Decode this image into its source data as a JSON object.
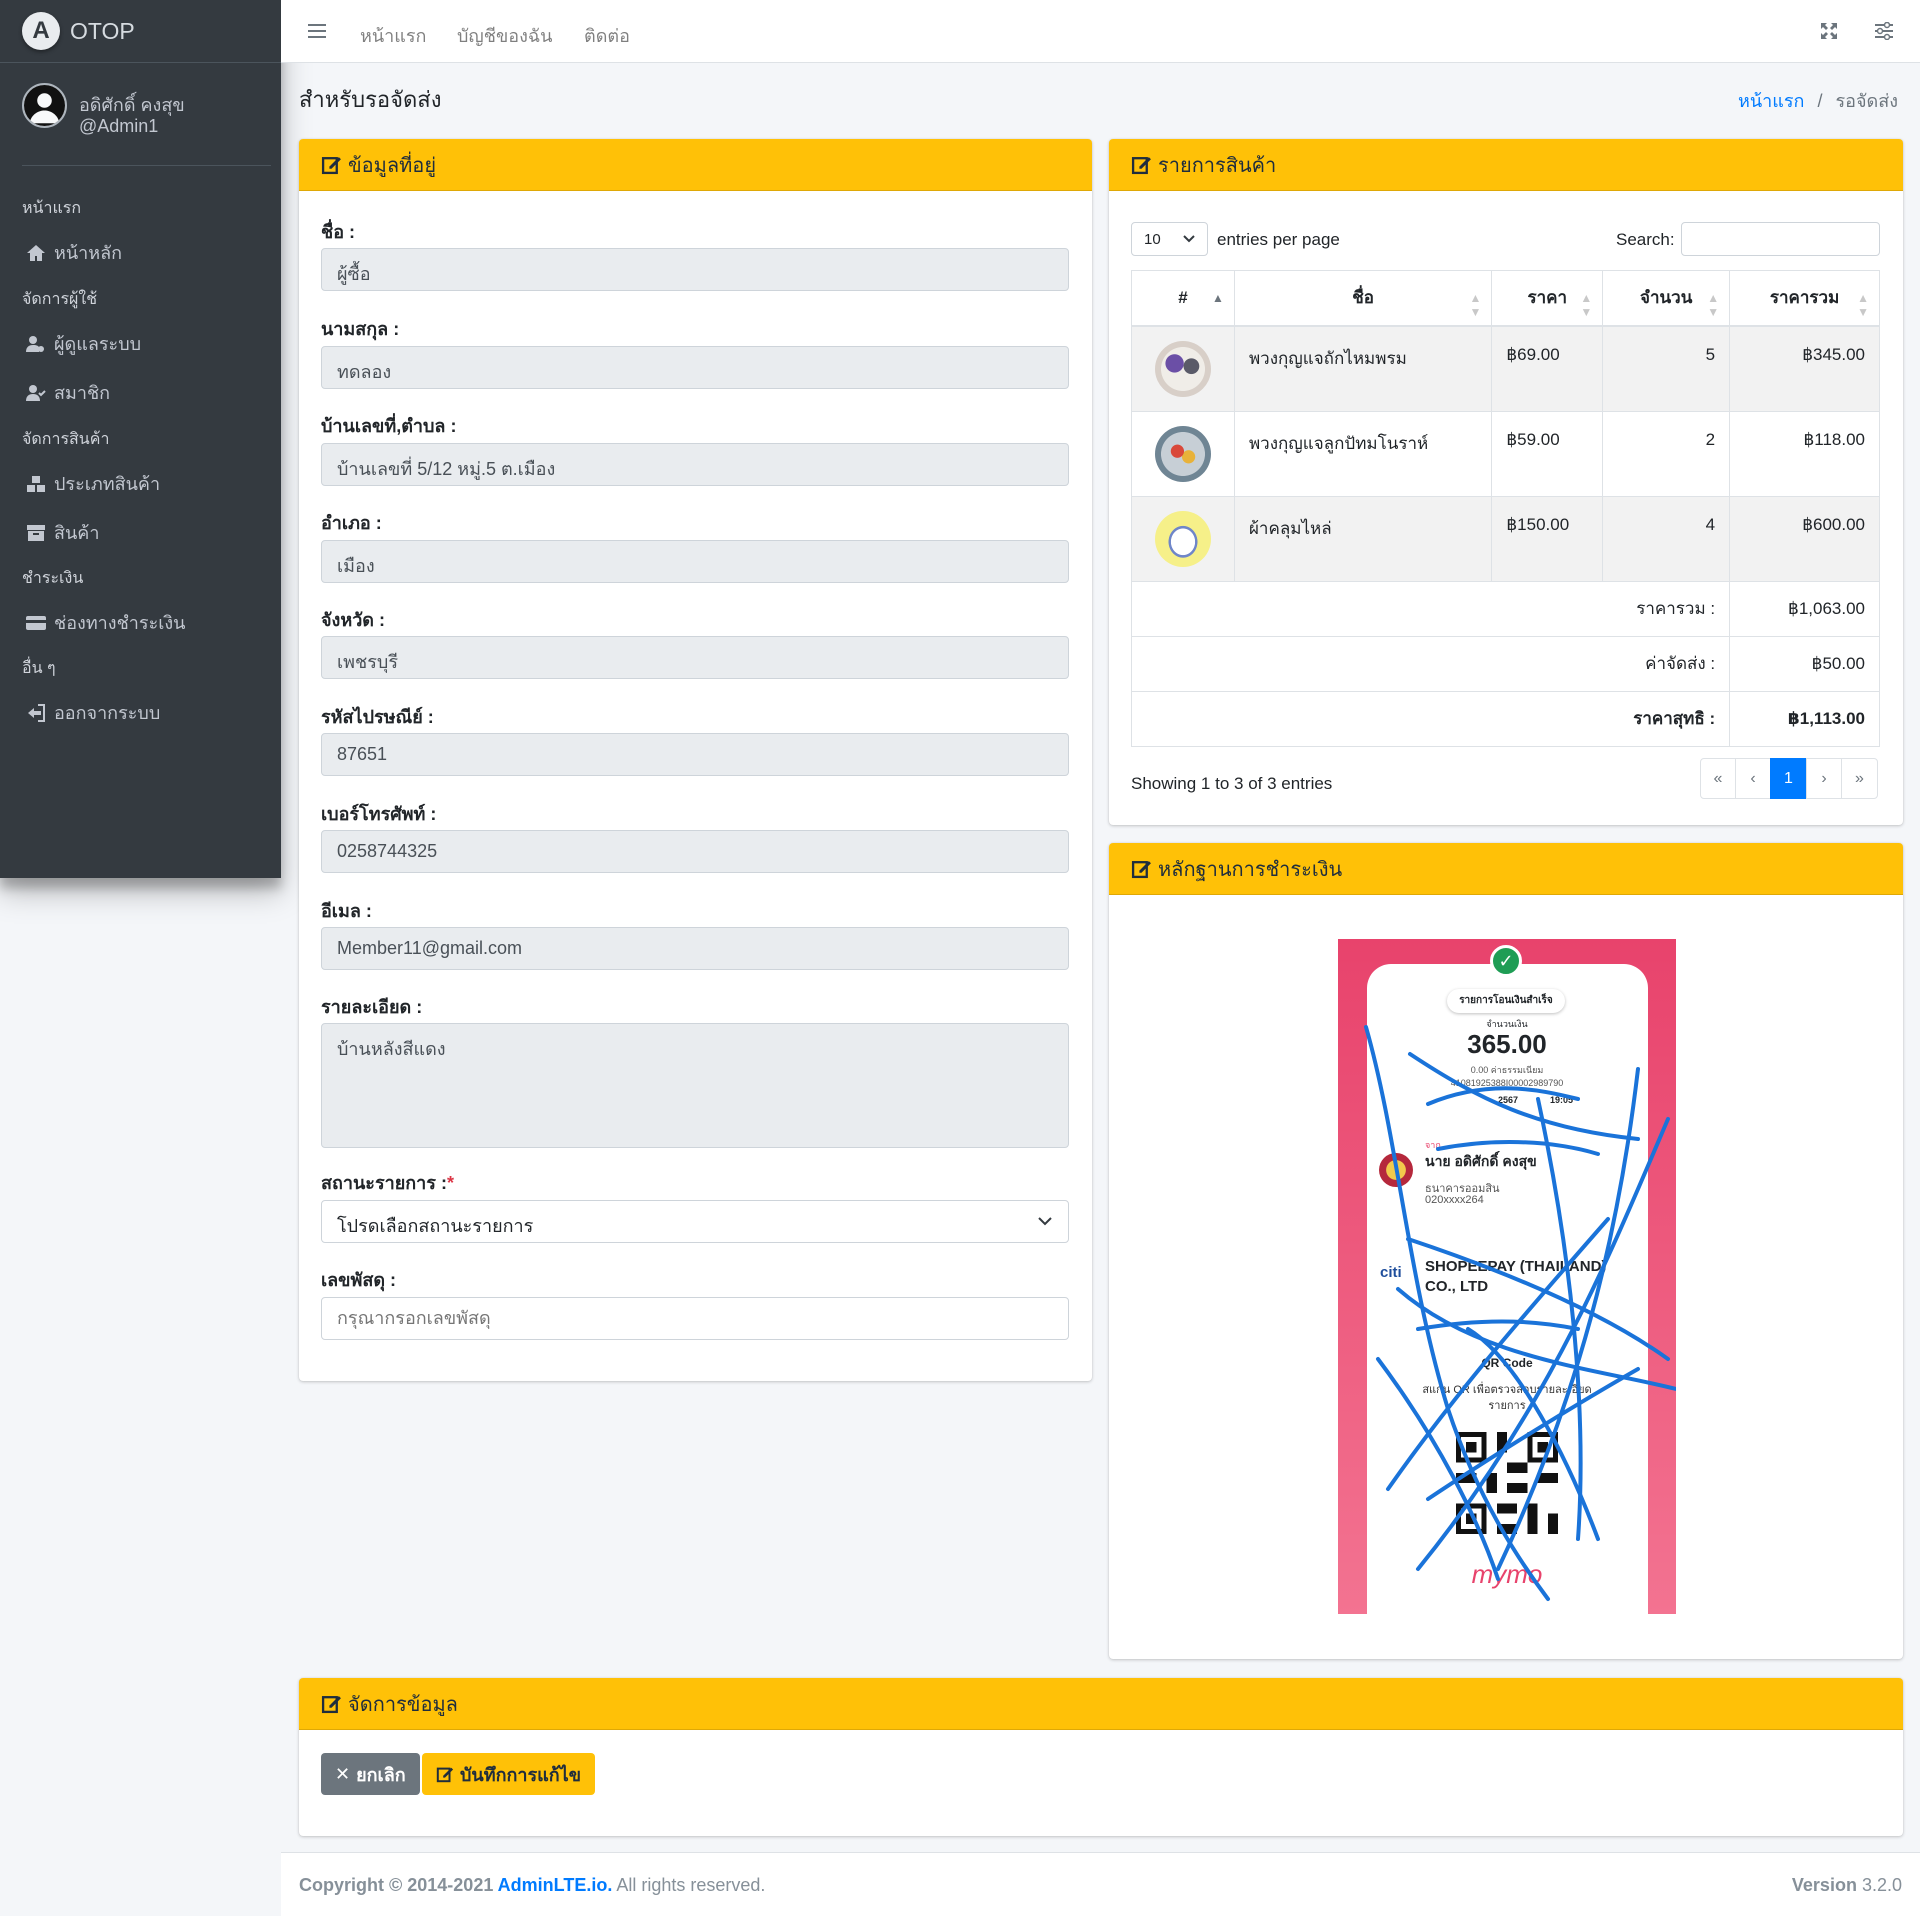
{
  "brand": {
    "name": "OTOP",
    "logo_letter": "A"
  },
  "user": {
    "name": "อดิศักดิ์ คงสุข",
    "handle": "@Admin1"
  },
  "sidebar": {
    "headers": [
      "หน้าแรก",
      "จัดการผู้ใช้",
      "จัดการสินค้า",
      "ชำระเงิน",
      "อื่น ๆ"
    ],
    "items": [
      {
        "label": "หน้าหลัก",
        "icon": "home-icon"
      },
      {
        "label": "ผู้ดูแลระบบ",
        "icon": "user-cog-icon"
      },
      {
        "label": "สมาชิก",
        "icon": "user-check-icon"
      },
      {
        "label": "ประเภทสินค้า",
        "icon": "cubes-icon"
      },
      {
        "label": "สินค้า",
        "icon": "archive-icon"
      },
      {
        "label": "ช่องทางชำระเงิน",
        "icon": "credit-card-icon"
      },
      {
        "label": "ออกจากระบบ",
        "icon": "sign-out-icon"
      }
    ]
  },
  "topnav": {
    "links": [
      "หน้าแรก",
      "บัญชีของฉัน",
      "ติดต่อ"
    ]
  },
  "page": {
    "title": "สำหรับรอจัดส่ง",
    "breadcrumb_home": "หน้าแรก",
    "breadcrumb_sep": "/",
    "breadcrumb_current": "รอจัดส่ง"
  },
  "address_card": {
    "title": "ข้อมูลที่อยู่",
    "fields": [
      {
        "label": "ชื่อ :",
        "value": "ผู้ซื้อ"
      },
      {
        "label": "นามสกุล :",
        "value": "ทดลอง"
      },
      {
        "label": "บ้านเลขที่,ตำบล :",
        "value": "บ้านเลขที่ 5/12 หมู่.5 ต.เมือง"
      },
      {
        "label": "อำเภอ :",
        "value": "เมือง"
      },
      {
        "label": "จังหวัด :",
        "value": "เพชรบุรี"
      },
      {
        "label": "รหัสไปรษณีย์ :",
        "value": "87651"
      },
      {
        "label": "เบอร์โทรศัพท์ :",
        "value": "0258744325"
      },
      {
        "label": "อีเมล :",
        "value": "Member11@gmail.com"
      }
    ],
    "detail_label": "รายละเอียด :",
    "detail_value": "บ้านหลังสีแดง",
    "status_label": "สถานะรายการ :",
    "status_required": "*",
    "status_value": "โปรดเลือกสถานะรายการ",
    "tracking_label": "เลขพัสดุ :",
    "tracking_placeholder": "กรุณากรอกเลขพัสดุ"
  },
  "products_card": {
    "title": "รายการสินค้า",
    "page_length": "10",
    "entries_text": "entries per page",
    "search_label": "Search:",
    "columns": [
      "#",
      "ชื่อ",
      "ราคา",
      "จำนวน",
      "ราคารวม"
    ],
    "rows": [
      {
        "name": "พวงกุญแจถักไหมพรม",
        "price": "฿69.00",
        "qty": "5",
        "total": "฿345.00",
        "thumb_colors": [
          "#d8cfc8",
          "#6b4fa6",
          "#f0ede8"
        ]
      },
      {
        "name": "พวงกุญแจลูกปัทมโนราห์",
        "price": "฿59.00",
        "qty": "2",
        "total": "฿118.00",
        "thumb_colors": [
          "#8aa0b0",
          "#d9483a",
          "#e8b23a"
        ]
      },
      {
        "name": "ผ้าคลุมไหล่",
        "price": "฿150.00",
        "qty": "4",
        "total": "฿600.00",
        "thumb_colors": [
          "#f6f089",
          "#ffffff",
          "#6f86c9"
        ]
      }
    ],
    "summary": [
      {
        "label": "ราคารวม :",
        "value": "฿1,063.00"
      },
      {
        "label": "ค่าจัดส่ง :",
        "value": "฿50.00"
      },
      {
        "label": "ราคาสุทธิ :",
        "value": "฿1,113.00"
      }
    ],
    "info": "Showing 1 to 3 of 3 entries",
    "pagination": [
      "«",
      "‹",
      "1",
      "›",
      "»"
    ]
  },
  "payment_card": {
    "title": "หลักฐานการชำระเงิน",
    "slip": {
      "title": "รายการโอนเงินสำเร็จ",
      "amount_label": "จำนวนเงิน",
      "amount": "365.00",
      "fee": "0.00 ค่าธรรมเนียม",
      "ref": "41081925388I00002989790",
      "date": "2567",
      "time": "19:05",
      "from_label": "จาก",
      "from_name": "นาย อดิศักดิ์ คงสุข",
      "from_bank": "ธนาคารออมสิน",
      "from_acct": "020xxxx264",
      "to_bank_logo": "citi",
      "to_name": "SHOPEEPAY (THAILAND) CO., LTD",
      "qr_title": "QR Code",
      "qr_desc": "สแกน QR เพื่อตรวจสอบรายละเอียดรายการ",
      "brand": "mymo"
    }
  },
  "manage_card": {
    "title": "จัดการข้อมูล",
    "cancel": "ยกเลิก",
    "save": "บันทึกการแก้ไข"
  },
  "footer": {
    "copyright": "Copyright © 2014-2021 ",
    "link": "AdminLTE.io.",
    "rights": " All rights reserved.",
    "version_label": "Version",
    "version": "3.2.0"
  },
  "colors": {
    "accent": "#ffc107",
    "primary": "#007bff",
    "sidebar": "#343a40",
    "slip_pink": "#e8436c",
    "scribble": "#1a73d9"
  }
}
